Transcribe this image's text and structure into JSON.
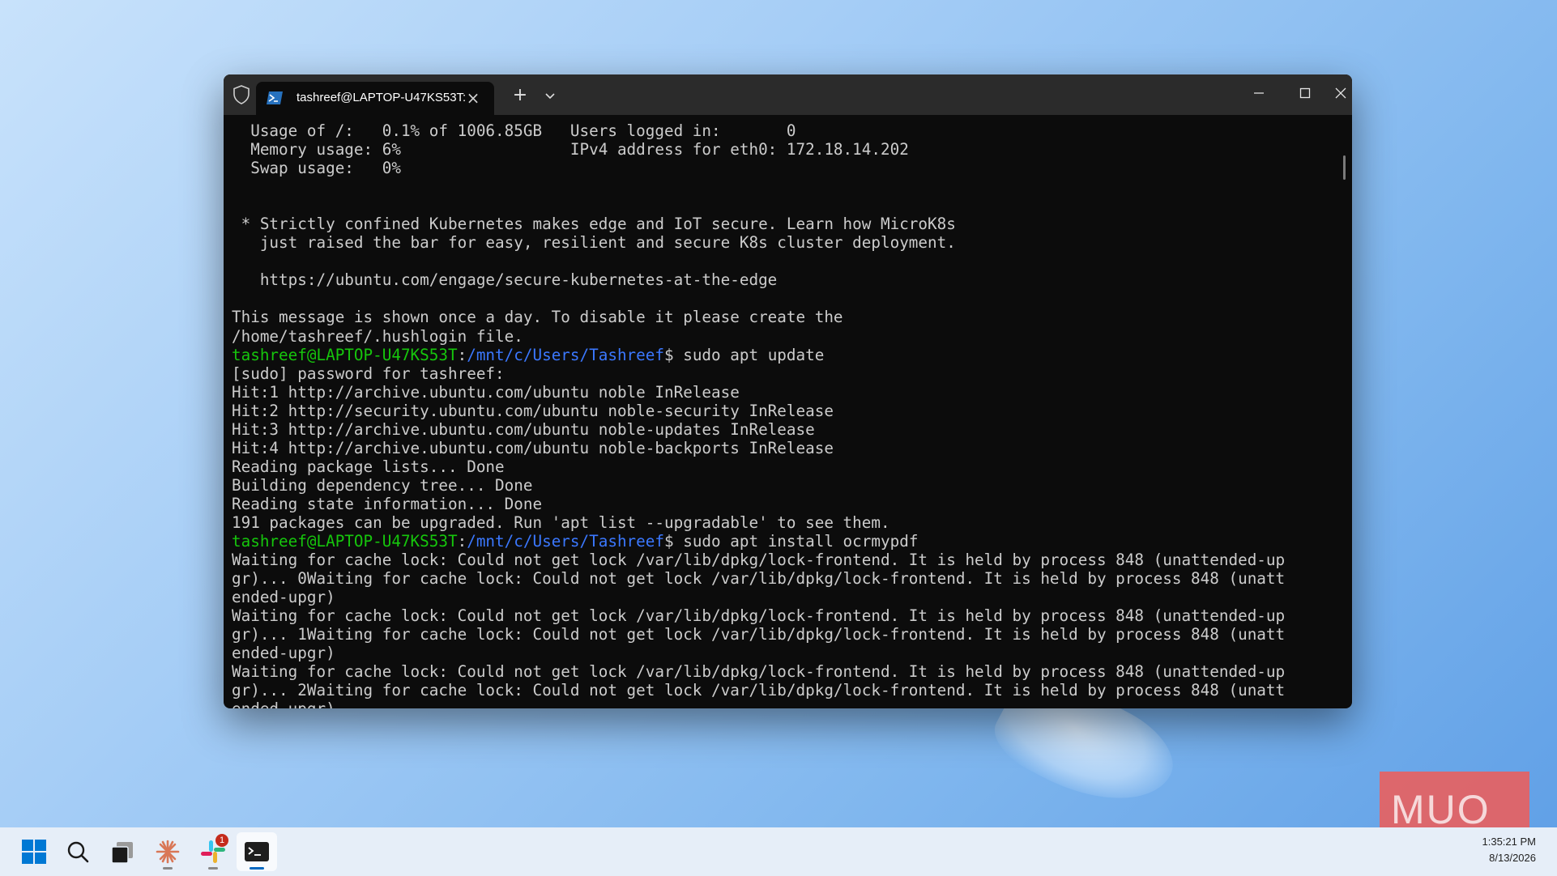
{
  "tab": {
    "title": "tashreef@LAPTOP-U47KS53T:"
  },
  "terminal": {
    "lines": [
      [
        {
          "t": "  Usage of /:   0.1% of 1006.85GB   Users logged in:       0"
        }
      ],
      [
        {
          "t": "  Memory usage: 6%                  IPv4 address for eth0: 172.18.14.202"
        }
      ],
      [
        {
          "t": "  Swap usage:   0%"
        }
      ],
      [
        {
          "t": ""
        }
      ],
      [
        {
          "t": ""
        }
      ],
      [
        {
          "t": " * Strictly confined Kubernetes makes edge and IoT secure. Learn how MicroK8s"
        }
      ],
      [
        {
          "t": "   just raised the bar for easy, resilient and secure K8s cluster deployment."
        }
      ],
      [
        {
          "t": ""
        }
      ],
      [
        {
          "t": "   https://ubuntu.com/engage/secure-kubernetes-at-the-edge"
        }
      ],
      [
        {
          "t": ""
        }
      ],
      [
        {
          "t": "This message is shown once a day. To disable it please create the"
        }
      ],
      [
        {
          "t": "/home/tashreef/.hushlogin file."
        }
      ],
      [
        {
          "t": "tashreef@LAPTOP-U47KS53T",
          "c": "u"
        },
        {
          "t": ":"
        },
        {
          "t": "/mnt/c/Users/Tashreef",
          "c": "p"
        },
        {
          "t": "$ sudo apt update"
        }
      ],
      [
        {
          "t": "[sudo] password for tashreef:"
        }
      ],
      [
        {
          "t": "Hit:1 http://archive.ubuntu.com/ubuntu noble InRelease"
        }
      ],
      [
        {
          "t": "Hit:2 http://security.ubuntu.com/ubuntu noble-security InRelease"
        }
      ],
      [
        {
          "t": "Hit:3 http://archive.ubuntu.com/ubuntu noble-updates InRelease"
        }
      ],
      [
        {
          "t": "Hit:4 http://archive.ubuntu.com/ubuntu noble-backports InRelease"
        }
      ],
      [
        {
          "t": "Reading package lists... Done"
        }
      ],
      [
        {
          "t": "Building dependency tree... Done"
        }
      ],
      [
        {
          "t": "Reading state information... Done"
        }
      ],
      [
        {
          "t": "191 packages can be upgraded. Run 'apt list --upgradable' to see them."
        }
      ],
      [
        {
          "t": "tashreef@LAPTOP-U47KS53T",
          "c": "u"
        },
        {
          "t": ":"
        },
        {
          "t": "/mnt/c/Users/Tashreef",
          "c": "p"
        },
        {
          "t": "$ sudo apt install ocrmypdf"
        }
      ],
      [
        {
          "t": "Waiting for cache lock: Could not get lock /var/lib/dpkg/lock-frontend. It is held by process 848 (unattended-up"
        }
      ],
      [
        {
          "t": "gr)... 0Waiting for cache lock: Could not get lock /var/lib/dpkg/lock-frontend. It is held by process 848 (unatt"
        }
      ],
      [
        {
          "t": "ended-upgr)"
        }
      ],
      [
        {
          "t": "Waiting for cache lock: Could not get lock /var/lib/dpkg/lock-frontend. It is held by process 848 (unattended-up"
        }
      ],
      [
        {
          "t": "gr)... 1Waiting for cache lock: Could not get lock /var/lib/dpkg/lock-frontend. It is held by process 848 (unatt"
        }
      ],
      [
        {
          "t": "ended-upgr)"
        }
      ],
      [
        {
          "t": "Waiting for cache lock: Could not get lock /var/lib/dpkg/lock-frontend. It is held by process 848 (unattended-up"
        }
      ],
      [
        {
          "t": "gr)... 2Waiting for cache lock: Could not get lock /var/lib/dpkg/lock-frontend. It is held by process 848 (unatt"
        }
      ],
      [
        {
          "t": "ended-upgr)"
        }
      ]
    ]
  },
  "taskbar": {
    "slack_badge": "1",
    "time": "1:35:21 PM",
    "date": "8/13/2026"
  },
  "watermark": "MUO",
  "colors": {
    "user": "#16c60c",
    "path": "#3b78ff",
    "text": "#cccccc",
    "accent": "#0067c0"
  }
}
